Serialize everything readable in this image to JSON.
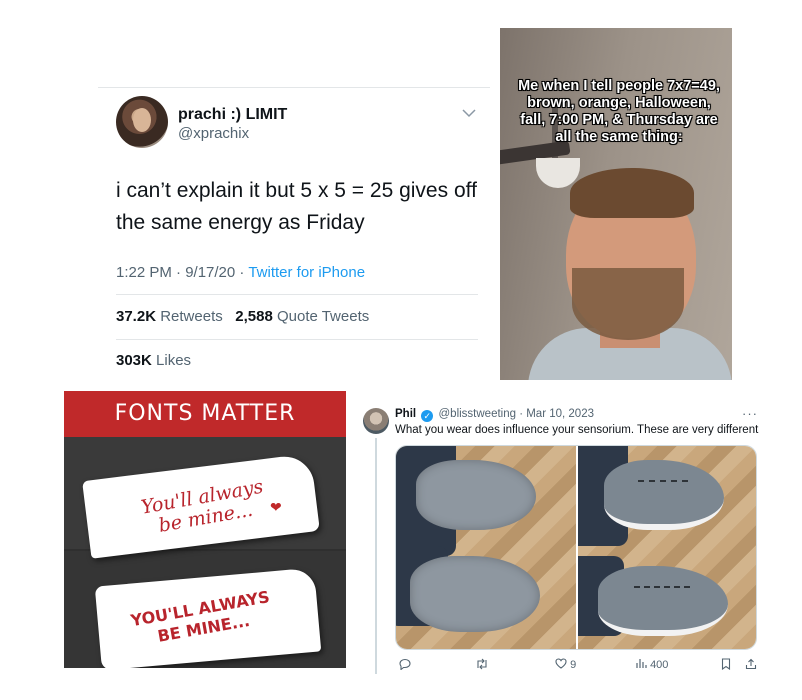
{
  "tweet1": {
    "name": "prachi :) LIMIT",
    "handle": "@xprachix",
    "text": "i can’t explain it but 5 x 5 = 25 gives off the same energy as Friday",
    "time": "1:22 PM · 9/17/20 · ",
    "source": "Twitter for iPhone",
    "retweets_count": "37.2K",
    "retweets_label": "Retweets",
    "quotes_count": "2,588",
    "quotes_label": "Quote Tweets",
    "likes_count": "303K",
    "likes_label": "Likes"
  },
  "meme": {
    "caption": "Me when I tell people 7x7=49, brown, orange, Halloween, fall, 7:00 PM, & Thursday are all the same thing:"
  },
  "fonts_matter": {
    "title": "FONTS MATTER",
    "script_line1": "You'll always",
    "script_line2": "be mine...",
    "caps_line1": "YOU'LL ALWAYS",
    "caps_line2": "BE MINE..."
  },
  "tweet2": {
    "name": "Phil",
    "handle_date": "@blisstweeting · Mar 10, 2023",
    "more": "···",
    "text": "What you wear does influence your sensorium. These are very different",
    "actions": {
      "likes": "9",
      "views": "400"
    }
  },
  "colors": {
    "twitter_blue": "#1d9bf0",
    "fonts_red": "#c0292a"
  }
}
